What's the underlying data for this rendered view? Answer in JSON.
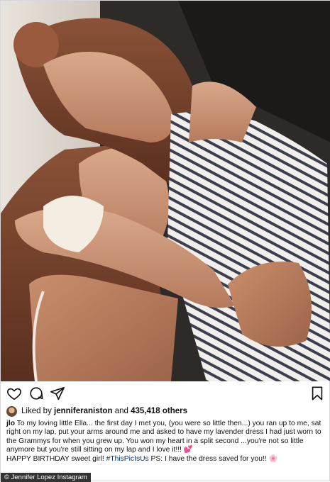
{
  "post": {
    "likes": {
      "prefix": "Liked by",
      "user": "jenniferaniston",
      "and": "and",
      "count": "435,418 others"
    },
    "caption": {
      "username": "jlo",
      "line1": "To my loving little Ella... the first day I met you, (you were so little then...) you ran up to me, sat right on my lap, put your arms around me and asked to have my lavender dress I had just worn to the Grammys for when you grew up. You won my heart in a split second ...you're not so little anymore but you're still sitting on my lap and I love it!!! ",
      "heart_emoji": "💕",
      "line2_start": "HAPPY BIRTHDAY sweet girl! ",
      "hashtag": "#ThisPicIsUs",
      "line2_end": " PS: I have the dress saved for you!! ",
      "flower_emoji": "🌸"
    }
  },
  "credit": "© Jennifer Lopez Instagram",
  "icons": {
    "like": "heart-icon",
    "comment": "comment-icon",
    "share": "share-icon",
    "save": "bookmark-icon"
  },
  "colors": {
    "hashtag": "#00376b",
    "credit_bg": "#333333"
  }
}
